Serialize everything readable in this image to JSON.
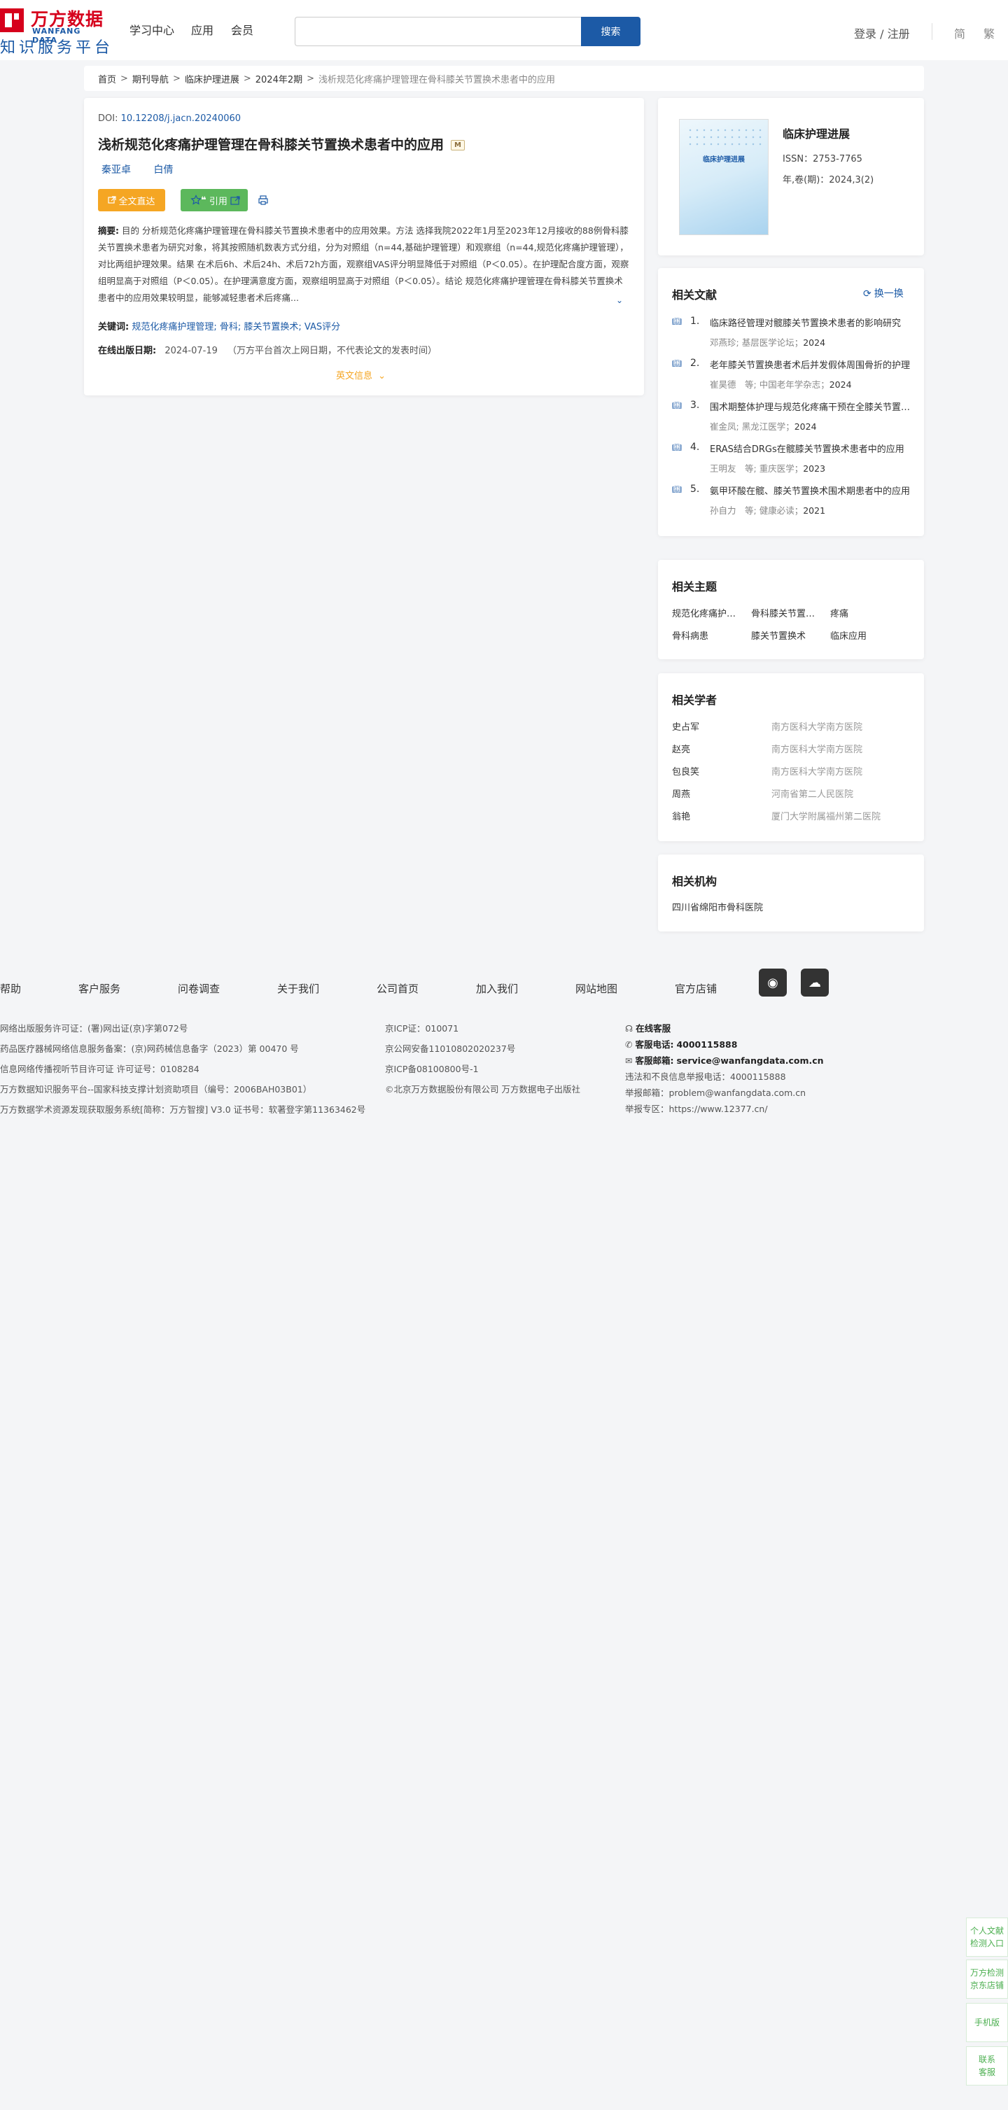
{
  "header": {
    "logo_cn": "万方数据",
    "logo_en": "WANFANG DATA",
    "logo_sub": "知识服务平台",
    "nav": [
      "学习中心",
      "应用",
      "会员"
    ],
    "search_placeholder": "",
    "search_button": "搜索",
    "login": "登录 / 注册",
    "lang_simplified": "简",
    "lang_traditional": "繁"
  },
  "breadcrumb": {
    "items": [
      "首页",
      "期刊导航",
      "临床护理进展",
      "2024年2期"
    ],
    "current": "浅析规范化疼痛护理管理在骨科膝关节置换术患者中的应用"
  },
  "article": {
    "doi_label": "DOI:",
    "doi": "10.12208/j.jacn.20240060",
    "title": "浅析规范化疼痛护理管理在骨科膝关节置换术患者中的应用",
    "badge": "M",
    "authors": [
      "秦亚卓",
      "白倩"
    ],
    "read_button": "全文直达",
    "cite_button": "引用",
    "abstract_label": "摘要:",
    "abstract": "目的 分析规范化疼痛护理管理在骨科膝关节置换术患者中的应用效果。方法 选择我院2022年1月至2023年12月接收的88例骨科膝关节置换术患者为研究对象，将其按照随机数表方式分组，分为对照组（n=44,基础护理管理）和观察组（n=44,规范化疼痛护理管理），对比两组护理效果。结果 在术后6h、术后24h、术后72h方面，观察组VAS评分明显降低于对照组（P＜0.05）。在护理配合度方面，观察组明显高于对照组（P＜0.05）。在护理满意度方面，观察组明显高于对照组（P＜0.05）。结论 规范化疼痛护理管理在骨科膝关节置换术患者中的应用效果较明显，能够减轻患者术后疼痛...",
    "keywords_label": "关键词:",
    "keywords": "规范化疼痛护理管理; 骨科; 膝关节置换术; VAS评分",
    "pubdate_label": "在线出版日期:",
    "pubdate": "2024-07-19",
    "pubdate_note": "（万方平台首次上网日期，不代表论文的发表时间）",
    "english_info": "英文信息"
  },
  "journal": {
    "cover_title": "临床护理进展",
    "name": "临床护理进展",
    "issn": "ISSN：2753-7765",
    "volume": "年,卷(期)：2024,3(2)"
  },
  "related_docs": {
    "title": "相关文献",
    "refresh": "换一换",
    "items": [
      {
        "num": "1.",
        "title": "临床路径管理对髋膝关节置换术患者的影响研究",
        "authors": "邓燕珍;",
        "source": "基层医学论坛；",
        "year": "2024"
      },
      {
        "num": "2.",
        "title": "老年膝关节置换患者术后并发假体周围骨折的护理",
        "authors": "崔昊德　等;",
        "source": "中国老年学杂志；",
        "year": "2024"
      },
      {
        "num": "3.",
        "title": "围术期整体护理与规范化疼痛干预在全膝关节置换中的应用",
        "authors": "崔金凤;",
        "source": "黑龙江医学；",
        "year": "2024"
      },
      {
        "num": "4.",
        "title": "ERAS结合DRGs在髋膝关节置换术患者中的应用",
        "authors": "王明友　等;",
        "source": "重庆医学；",
        "year": "2023"
      },
      {
        "num": "5.",
        "title": "氨甲环酸在髋、膝关节置换术围术期患者中的应用",
        "authors": "孙自力　等;",
        "source": "健康必读；",
        "year": "2021"
      }
    ]
  },
  "related_topics": {
    "title": "相关主题",
    "items": [
      "规范化疼痛护理管理",
      "骨科膝关节置换术",
      "疼痛",
      "骨科病患",
      "膝关节置换术",
      "临床应用"
    ]
  },
  "related_scholars": {
    "title": "相关学者",
    "items": [
      {
        "name": "史占军",
        "org": "南方医科大学南方医院"
      },
      {
        "name": "赵亮",
        "org": "南方医科大学南方医院"
      },
      {
        "name": "包良笑",
        "org": "南方医科大学南方医院"
      },
      {
        "name": "周燕",
        "org": "河南省第二人民医院"
      },
      {
        "name": "翁艳",
        "org": "厦门大学附属福州第二医院"
      }
    ]
  },
  "related_orgs": {
    "title": "相关机构",
    "items": [
      "四川省绵阳市骨科医院"
    ]
  },
  "footer": {
    "nav": [
      "帮助",
      "客户服务",
      "问卷调查",
      "关于我们",
      "公司首页",
      "加入我们",
      "网站地图",
      "官方店铺"
    ],
    "col1": [
      "网络出版服务许可证：(署)网出证(京)字第072号",
      "药品医疗器械网络信息服务备案：(京)网药械信息备字（2023）第 00470 号",
      "信息网络传播视听节目许可证 许可证号：0108284",
      "万方数据知识服务平台--国家科技支撑计划资助项目（编号：2006BAH03B01）",
      "万方数据学术资源发现获取服务系统[简称：万方智搜] V3.0 证书号：软著登字第11363462号"
    ],
    "col2": [
      "京ICP证：010071",
      "京公网安备11010802020237号",
      "京ICP备08100800号-1",
      "©北京万方数据股份有限公司 万方数据电子出版社"
    ],
    "online_service": "在线客服",
    "phone_label": "客服电话:",
    "phone": "4000115888",
    "email_label": "客服邮箱:",
    "email": "service@wanfangdata.com.cn",
    "report_phone": "违法和不良信息举报电话：4000115888",
    "report_email": "举报邮箱：problem@wanfangdata.com.cn",
    "report_area": "举报专区：https://www.12377.cn/"
  },
  "side_float": {
    "check": "个人文献检测入口",
    "shop": "万方检测京东店铺",
    "mobile": "手机版",
    "service": "联系客服"
  }
}
